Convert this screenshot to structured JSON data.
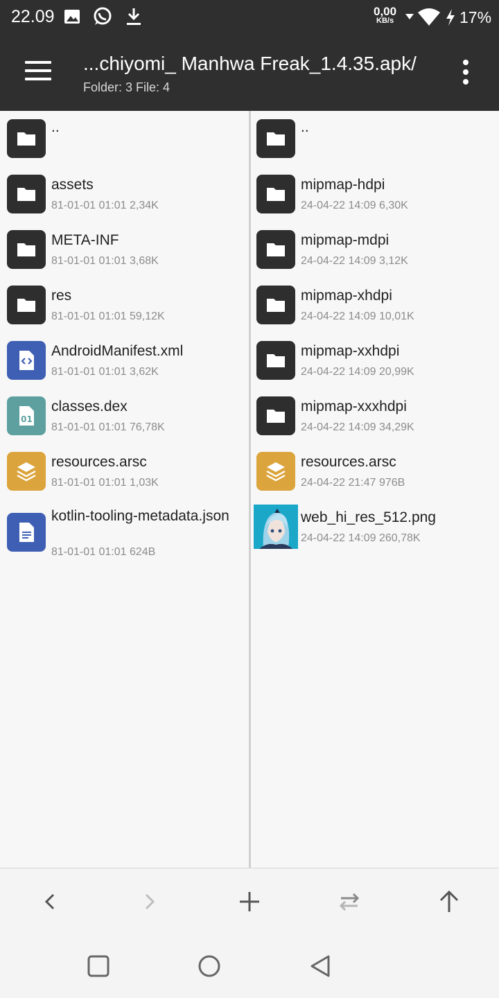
{
  "status_bar": {
    "time": "22.09",
    "icons": [
      "image-icon",
      "whatsapp-icon",
      "download-icon"
    ],
    "net_speed": "0,00",
    "net_unit": "KB/s",
    "battery": "17%"
  },
  "app_bar": {
    "title": "...chiyomi_ Manhwa Freak_1.4.35.apk/",
    "subtitle": "Folder: 3  File: 4"
  },
  "left_pane": {
    "items": [
      {
        "name": "..",
        "meta": "",
        "icon": "folder-icon"
      },
      {
        "name": "assets",
        "meta": "81-01-01 01:01  2,34K",
        "icon": "folder-icon"
      },
      {
        "name": "META-INF",
        "meta": "81-01-01 01:01  3,68K",
        "icon": "folder-icon"
      },
      {
        "name": "res",
        "meta": "81-01-01 01:01  59,12K",
        "icon": "folder-icon"
      },
      {
        "name": "AndroidManifest.xml",
        "meta": "81-01-01 01:01  3,62K",
        "icon": "xml-file-icon"
      },
      {
        "name": "classes.dex",
        "meta": "81-01-01 01:01  76,78K",
        "icon": "binary-file-icon"
      },
      {
        "name": "resources.arsc",
        "meta": "81-01-01 01:01  1,03K",
        "icon": "layers-file-icon"
      },
      {
        "name": "kotlin-tooling-metadata.json",
        "meta": "81-01-01 01:01  624B",
        "icon": "document-file-icon"
      }
    ]
  },
  "right_pane": {
    "items": [
      {
        "name": "..",
        "meta": "",
        "icon": "folder-icon"
      },
      {
        "name": "mipmap-hdpi",
        "meta": "24-04-22 14:09  6,30K",
        "icon": "folder-icon"
      },
      {
        "name": "mipmap-mdpi",
        "meta": "24-04-22 14:09  3,12K",
        "icon": "folder-icon"
      },
      {
        "name": "mipmap-xhdpi",
        "meta": "24-04-22 14:09  10,01K",
        "icon": "folder-icon"
      },
      {
        "name": "mipmap-xxhdpi",
        "meta": "24-04-22 14:09  20,99K",
        "icon": "folder-icon"
      },
      {
        "name": "mipmap-xxxhdpi",
        "meta": "24-04-22 14:09  34,29K",
        "icon": "folder-icon"
      },
      {
        "name": "resources.arsc",
        "meta": "24-04-22 21:47  976B",
        "icon": "layers-file-icon"
      },
      {
        "name": "web_hi_res_512.png",
        "meta": "24-04-22 14:09  260,78K",
        "icon": "image-thumbnail"
      }
    ]
  },
  "toolbar": {
    "buttons": [
      "back-icon",
      "forward-icon",
      "add-icon",
      "swap-icon",
      "up-icon"
    ]
  },
  "colors": {
    "bar": "#2f2f2f",
    "folder": "#2e2e2e",
    "xml": "#3f5fb4",
    "dex": "#5ea0a0",
    "arsc": "#dba43c",
    "doc": "#3f5fb4"
  }
}
